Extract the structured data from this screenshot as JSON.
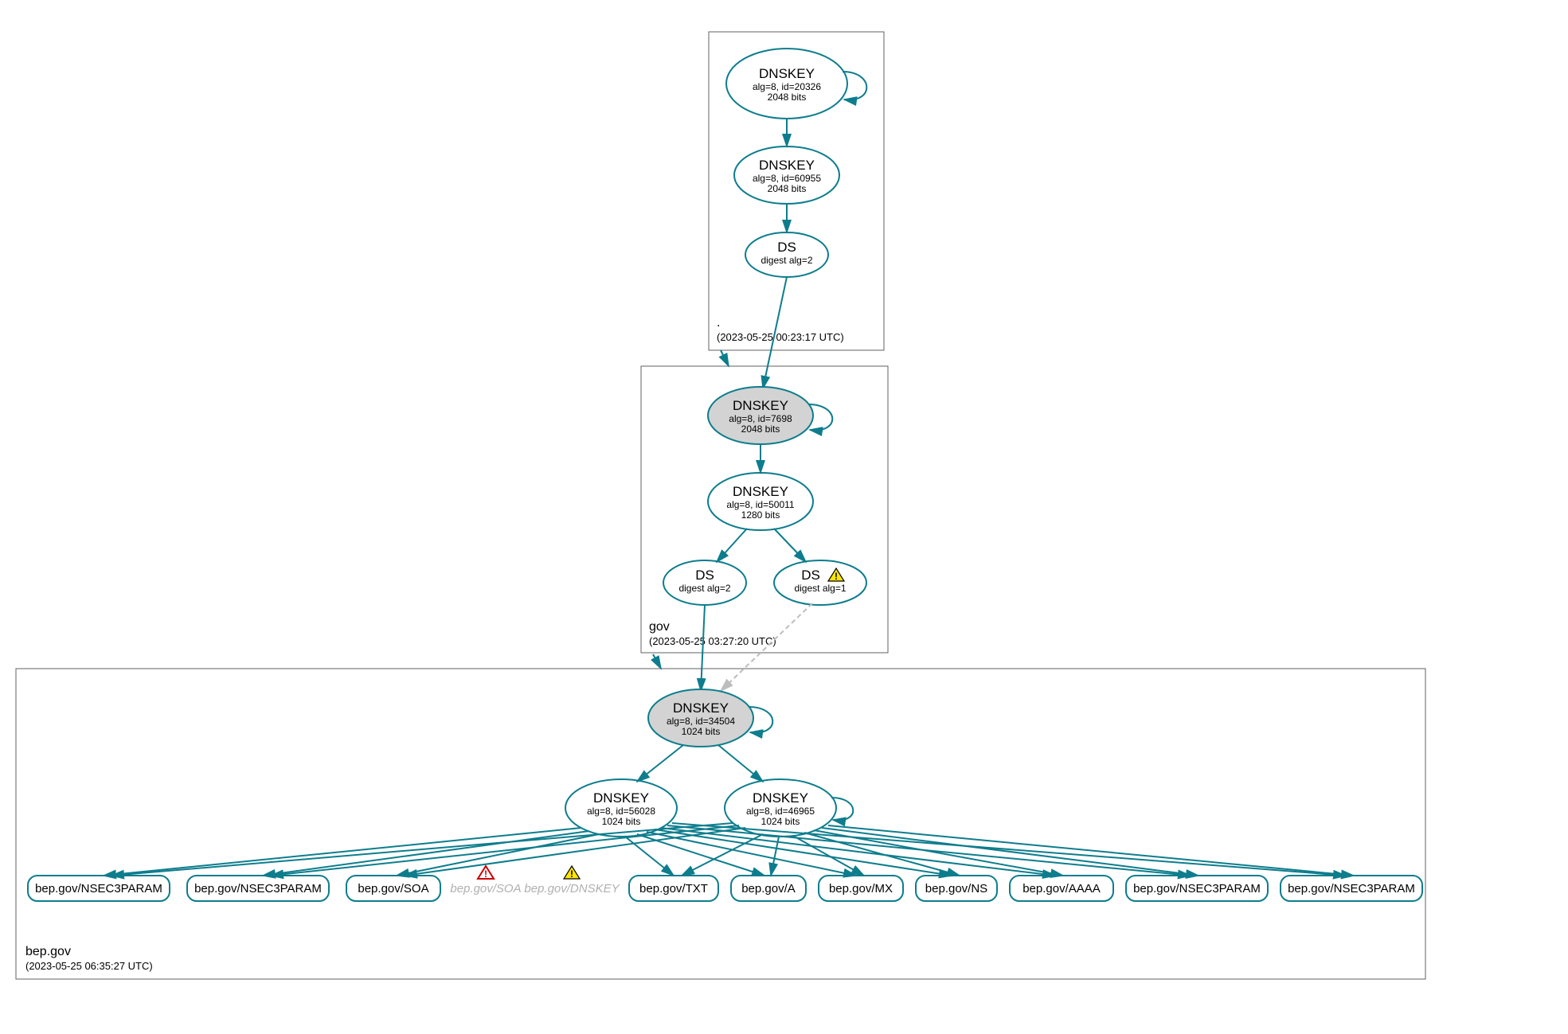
{
  "colors": {
    "teal": "#0d7d8d",
    "fill_gray": "#d3d3d3",
    "dashed_gray": "#bdbdbd"
  },
  "zones": {
    "root": {
      "name": ".",
      "timestamp": "(2023-05-25 00:23:17 UTC)"
    },
    "gov": {
      "name": "gov",
      "timestamp": "(2023-05-25 03:27:20 UTC)"
    },
    "bep": {
      "name": "bep.gov",
      "timestamp": "(2023-05-25 06:35:27 UTC)"
    }
  },
  "nodes": {
    "root_ksk": {
      "title": "DNSKEY",
      "line2": "alg=8, id=20326",
      "line3": "2048 bits"
    },
    "root_zsk": {
      "title": "DNSKEY",
      "line2": "alg=8, id=60955",
      "line3": "2048 bits"
    },
    "root_ds": {
      "title": "DS",
      "line2": "digest alg=2",
      "line3": ""
    },
    "gov_ksk": {
      "title": "DNSKEY",
      "line2": "alg=8, id=7698",
      "line3": "2048 bits"
    },
    "gov_zsk": {
      "title": "DNSKEY",
      "line2": "alg=8, id=50011",
      "line3": "1280 bits"
    },
    "gov_ds1": {
      "title": "DS",
      "line2": "digest alg=2",
      "line3": ""
    },
    "gov_ds2": {
      "title": "DS",
      "line2": "digest alg=1",
      "line3": ""
    },
    "bep_ksk": {
      "title": "DNSKEY",
      "line2": "alg=8, id=34504",
      "line3": "1024 bits"
    },
    "bep_zsk1": {
      "title": "DNSKEY",
      "line2": "alg=8, id=56028",
      "line3": "1024 bits"
    },
    "bep_zsk2": {
      "title": "DNSKEY",
      "line2": "alg=8, id=46965",
      "line3": "1024 bits"
    }
  },
  "rrsets": {
    "r1": "bep.gov/NSEC3PARAM",
    "r2": "bep.gov/NSEC3PARAM",
    "r3": "bep.gov/SOA",
    "r4": "bep.gov/SOA",
    "r5": "bep.gov/DNSKEY",
    "r6": "bep.gov/TXT",
    "r7": "bep.gov/A",
    "r8": "bep.gov/MX",
    "r9": "bep.gov/NS",
    "r10": "bep.gov/AAAA",
    "r11": "bep.gov/NSEC3PARAM",
    "r12": "bep.gov/NSEC3PARAM"
  }
}
